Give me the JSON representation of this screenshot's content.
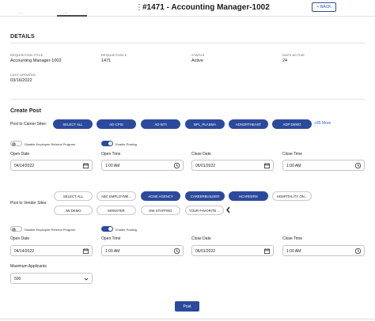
{
  "header": {
    "kebab": "⋮",
    "title": "#1471 - Accounting Manager-1002",
    "back_label": "< BACK",
    "tab_fragment_left": "...",
    "tab_fragment_right": "...."
  },
  "details": {
    "title": "DETAILS",
    "requisition_title_label": "REQUISITION TITLE",
    "requisition_title_value": "Accounting Manager-1002",
    "requisition_number_label": "REQUISITION #",
    "requisition_number_value": "1471",
    "status_label": "STATUS",
    "status_value": "Active",
    "days_active_label": "DAYS ACTIVE",
    "days_active_value": "24",
    "last_updated_label": "LAST UPDATED",
    "last_updated_value": "03/16/2022"
  },
  "create_post": {
    "title": "Create Post",
    "career_sites_label": "Post to Career Sites:",
    "career_sites": [
      {
        "label": "SELECT ALL",
        "selected": true
      },
      {
        "label": "AD-CPSI",
        "selected": true
      },
      {
        "label": "AD-WTI",
        "selected": true
      },
      {
        "label": "BPL_PLASMA",
        "selected": true
      },
      {
        "label": "ADNORTHEAST",
        "selected": true
      },
      {
        "label": "ADP DEMO",
        "selected": true
      }
    ],
    "more_label": "+95 More",
    "career": {
      "erp_toggle_label": "Disable Employee Referral Program",
      "erp_on": false,
      "posting_toggle_label": "Enable Posting",
      "posting_on": true,
      "open_date_label": "Open Date",
      "open_date": "04/14/2022",
      "open_time_label": "Open Time",
      "open_time": "1:00 AM",
      "close_date_label": "Close Date",
      "close_date": "06/01/2022",
      "close_time_label": "Close Time",
      "close_time": "1:00 AM"
    },
    "vendor_sites_label": "Post to Vendor Sites:",
    "vendor_sites": [
      {
        "label": "SELECT ALL",
        "selected": false
      },
      {
        "label": "ABC EMPLOYME...",
        "selected": false
      },
      {
        "label": "ACME AGENCY",
        "selected": true
      },
      {
        "label": "CAREERBUILDER",
        "selected": true
      },
      {
        "label": "HCAREERS",
        "selected": true
      },
      {
        "label": "HOSPITALITY ON...",
        "selected": false
      },
      {
        "label": "JW DEMO",
        "selected": false
      },
      {
        "label": "MONSTER",
        "selected": false
      },
      {
        "label": "NW STAFFING",
        "selected": false
      },
      {
        "label": "YOUR FAVORITE ...",
        "selected": false
      }
    ],
    "vendor": {
      "erp_toggle_label": "Disable Employee Referral Program",
      "erp_on": false,
      "posting_toggle_label": "Enable Posting",
      "posting_on": true,
      "open_date_label": "Open Date",
      "open_date": "04/14/2022",
      "open_time_label": "Open Time",
      "open_time": "1:00 AM",
      "close_date_label": "Close Date",
      "close_date": "06/01/2022",
      "close_time_label": "Close Time",
      "close_time": "1:00 AM"
    },
    "max_applicants_label": "Maximum Applicants",
    "max_applicants_value": "500",
    "post_label": "Post"
  },
  "colors": {
    "accent": "#2c4a9c",
    "link": "#2d5bd0",
    "border": "#c4c4c4"
  }
}
